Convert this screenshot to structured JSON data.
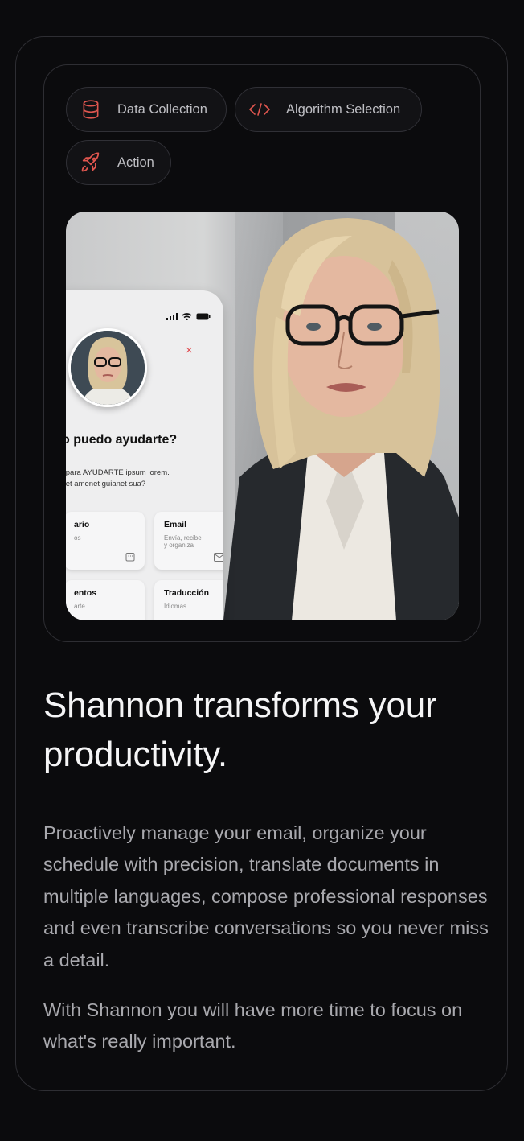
{
  "tags": [
    {
      "label": "Data Collection",
      "icon": "database-icon"
    },
    {
      "label": "Algorithm Selection",
      "icon": "code-icon"
    },
    {
      "label": "Action",
      "icon": "rocket-icon"
    }
  ],
  "phone": {
    "close": "×",
    "question": "o puedo ayudarte?",
    "subtitle_line1": "l para AYUDARTE ipsum lorem.",
    "subtitle_line2": "set amenet guianet sua?",
    "tiles": [
      {
        "title": "ario",
        "desc": "os",
        "icon": "calendar-icon"
      },
      {
        "title": "Email",
        "desc": "Envía, recibe\ny organiza",
        "icon": "mail-icon"
      },
      {
        "title": "entos",
        "desc": "arte",
        "icon": "document-icon"
      },
      {
        "title": "Traducción",
        "desc": "Idiomas",
        "icon": "translate-icon"
      }
    ]
  },
  "heading": "Shannon transforms your productivity.",
  "paragraph1": "Proactively manage your email, organize your schedule with precision, translate documents in multiple languages, compose professional responses and even transcribe conversations so you never miss a detail.",
  "paragraph2": "With Shannon you will have more time to focus on what's really important.",
  "colors": {
    "background": "#0b0b0d",
    "accent_icon": "#e0564f",
    "border": "#2e2e33"
  }
}
